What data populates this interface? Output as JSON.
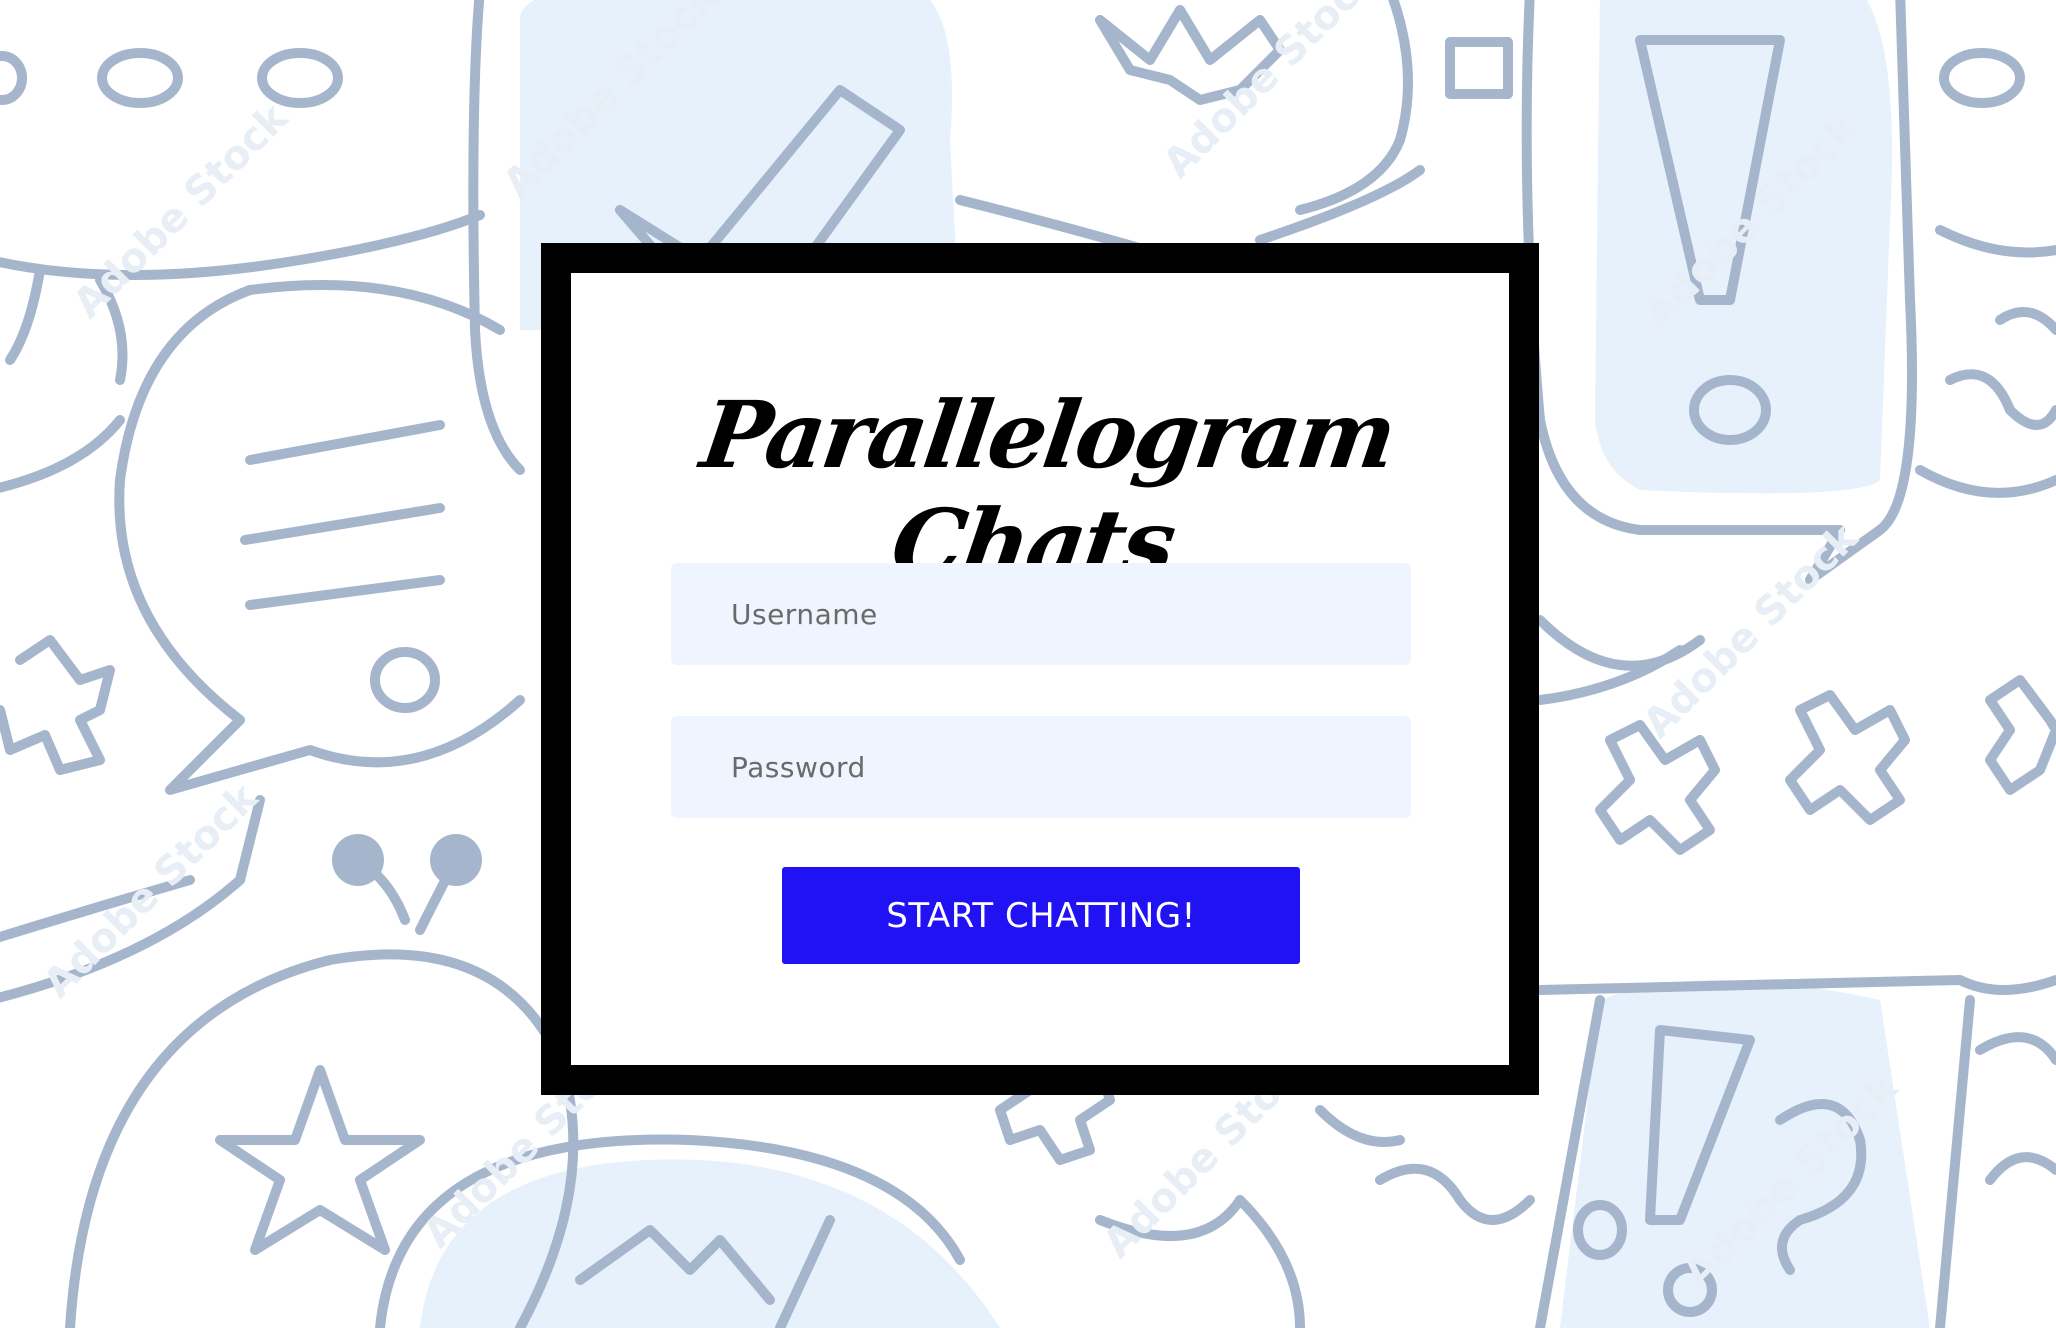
{
  "app": {
    "title": "Parallelogram Chats"
  },
  "login": {
    "username_placeholder": "Username",
    "password_placeholder": "Password",
    "submit_label": "START CHATTING!"
  },
  "background": {
    "watermark": "Adobe Stock"
  },
  "colors": {
    "button": "#2112f4",
    "field_background": "#eef5ff",
    "card_border": "#000000",
    "doodle_stroke": "#a5b6cc",
    "doodle_tint": "#e6f1fc"
  }
}
